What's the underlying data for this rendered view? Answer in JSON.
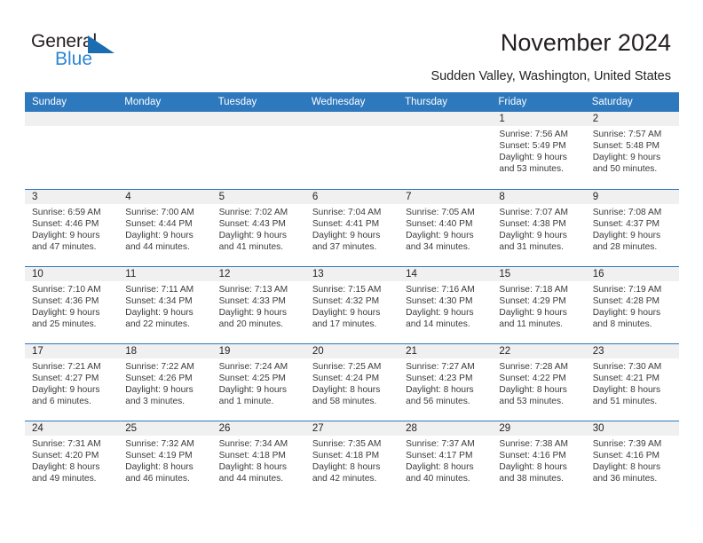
{
  "logo": {
    "word1": "General",
    "word2": "Blue",
    "triangle_color": "#1b6cb0",
    "word2_color": "#2b86d4"
  },
  "header": {
    "title": "November 2024",
    "subtitle": "Sudden Valley, Washington, United States"
  },
  "theme": {
    "header_blue": "#2e78bd",
    "daynum_gray": "#f0f0f0",
    "text": "#231f20"
  },
  "calendar": {
    "weekday_headers": [
      "Sunday",
      "Monday",
      "Tuesday",
      "Wednesday",
      "Thursday",
      "Friday",
      "Saturday"
    ],
    "weeks": [
      [
        {
          "day": "",
          "sunrise": "",
          "sunset": "",
          "daylight": "",
          "empty": true
        },
        {
          "day": "",
          "sunrise": "",
          "sunset": "",
          "daylight": "",
          "empty": true
        },
        {
          "day": "",
          "sunrise": "",
          "sunset": "",
          "daylight": "",
          "empty": true
        },
        {
          "day": "",
          "sunrise": "",
          "sunset": "",
          "daylight": "",
          "empty": true
        },
        {
          "day": "",
          "sunrise": "",
          "sunset": "",
          "daylight": "",
          "empty": true
        },
        {
          "day": "1",
          "sunrise": "Sunrise: 7:56 AM",
          "sunset": "Sunset: 5:49 PM",
          "daylight_l1": "Daylight: 9 hours",
          "daylight_l2": "and 53 minutes."
        },
        {
          "day": "2",
          "sunrise": "Sunrise: 7:57 AM",
          "sunset": "Sunset: 5:48 PM",
          "daylight_l1": "Daylight: 9 hours",
          "daylight_l2": "and 50 minutes."
        }
      ],
      [
        {
          "day": "3",
          "sunrise": "Sunrise: 6:59 AM",
          "sunset": "Sunset: 4:46 PM",
          "daylight_l1": "Daylight: 9 hours",
          "daylight_l2": "and 47 minutes."
        },
        {
          "day": "4",
          "sunrise": "Sunrise: 7:00 AM",
          "sunset": "Sunset: 4:44 PM",
          "daylight_l1": "Daylight: 9 hours",
          "daylight_l2": "and 44 minutes."
        },
        {
          "day": "5",
          "sunrise": "Sunrise: 7:02 AM",
          "sunset": "Sunset: 4:43 PM",
          "daylight_l1": "Daylight: 9 hours",
          "daylight_l2": "and 41 minutes."
        },
        {
          "day": "6",
          "sunrise": "Sunrise: 7:04 AM",
          "sunset": "Sunset: 4:41 PM",
          "daylight_l1": "Daylight: 9 hours",
          "daylight_l2": "and 37 minutes."
        },
        {
          "day": "7",
          "sunrise": "Sunrise: 7:05 AM",
          "sunset": "Sunset: 4:40 PM",
          "daylight_l1": "Daylight: 9 hours",
          "daylight_l2": "and 34 minutes."
        },
        {
          "day": "8",
          "sunrise": "Sunrise: 7:07 AM",
          "sunset": "Sunset: 4:38 PM",
          "daylight_l1": "Daylight: 9 hours",
          "daylight_l2": "and 31 minutes."
        },
        {
          "day": "9",
          "sunrise": "Sunrise: 7:08 AM",
          "sunset": "Sunset: 4:37 PM",
          "daylight_l1": "Daylight: 9 hours",
          "daylight_l2": "and 28 minutes."
        }
      ],
      [
        {
          "day": "10",
          "sunrise": "Sunrise: 7:10 AM",
          "sunset": "Sunset: 4:36 PM",
          "daylight_l1": "Daylight: 9 hours",
          "daylight_l2": "and 25 minutes."
        },
        {
          "day": "11",
          "sunrise": "Sunrise: 7:11 AM",
          "sunset": "Sunset: 4:34 PM",
          "daylight_l1": "Daylight: 9 hours",
          "daylight_l2": "and 22 minutes."
        },
        {
          "day": "12",
          "sunrise": "Sunrise: 7:13 AM",
          "sunset": "Sunset: 4:33 PM",
          "daylight_l1": "Daylight: 9 hours",
          "daylight_l2": "and 20 minutes."
        },
        {
          "day": "13",
          "sunrise": "Sunrise: 7:15 AM",
          "sunset": "Sunset: 4:32 PM",
          "daylight_l1": "Daylight: 9 hours",
          "daylight_l2": "and 17 minutes."
        },
        {
          "day": "14",
          "sunrise": "Sunrise: 7:16 AM",
          "sunset": "Sunset: 4:30 PM",
          "daylight_l1": "Daylight: 9 hours",
          "daylight_l2": "and 14 minutes."
        },
        {
          "day": "15",
          "sunrise": "Sunrise: 7:18 AM",
          "sunset": "Sunset: 4:29 PM",
          "daylight_l1": "Daylight: 9 hours",
          "daylight_l2": "and 11 minutes."
        },
        {
          "day": "16",
          "sunrise": "Sunrise: 7:19 AM",
          "sunset": "Sunset: 4:28 PM",
          "daylight_l1": "Daylight: 9 hours",
          "daylight_l2": "and 8 minutes."
        }
      ],
      [
        {
          "day": "17",
          "sunrise": "Sunrise: 7:21 AM",
          "sunset": "Sunset: 4:27 PM",
          "daylight_l1": "Daylight: 9 hours",
          "daylight_l2": "and 6 minutes."
        },
        {
          "day": "18",
          "sunrise": "Sunrise: 7:22 AM",
          "sunset": "Sunset: 4:26 PM",
          "daylight_l1": "Daylight: 9 hours",
          "daylight_l2": "and 3 minutes."
        },
        {
          "day": "19",
          "sunrise": "Sunrise: 7:24 AM",
          "sunset": "Sunset: 4:25 PM",
          "daylight_l1": "Daylight: 9 hours",
          "daylight_l2": "and 1 minute."
        },
        {
          "day": "20",
          "sunrise": "Sunrise: 7:25 AM",
          "sunset": "Sunset: 4:24 PM",
          "daylight_l1": "Daylight: 8 hours",
          "daylight_l2": "and 58 minutes."
        },
        {
          "day": "21",
          "sunrise": "Sunrise: 7:27 AM",
          "sunset": "Sunset: 4:23 PM",
          "daylight_l1": "Daylight: 8 hours",
          "daylight_l2": "and 56 minutes."
        },
        {
          "day": "22",
          "sunrise": "Sunrise: 7:28 AM",
          "sunset": "Sunset: 4:22 PM",
          "daylight_l1": "Daylight: 8 hours",
          "daylight_l2": "and 53 minutes."
        },
        {
          "day": "23",
          "sunrise": "Sunrise: 7:30 AM",
          "sunset": "Sunset: 4:21 PM",
          "daylight_l1": "Daylight: 8 hours",
          "daylight_l2": "and 51 minutes."
        }
      ],
      [
        {
          "day": "24",
          "sunrise": "Sunrise: 7:31 AM",
          "sunset": "Sunset: 4:20 PM",
          "daylight_l1": "Daylight: 8 hours",
          "daylight_l2": "and 49 minutes."
        },
        {
          "day": "25",
          "sunrise": "Sunrise: 7:32 AM",
          "sunset": "Sunset: 4:19 PM",
          "daylight_l1": "Daylight: 8 hours",
          "daylight_l2": "and 46 minutes."
        },
        {
          "day": "26",
          "sunrise": "Sunrise: 7:34 AM",
          "sunset": "Sunset: 4:18 PM",
          "daylight_l1": "Daylight: 8 hours",
          "daylight_l2": "and 44 minutes."
        },
        {
          "day": "27",
          "sunrise": "Sunrise: 7:35 AM",
          "sunset": "Sunset: 4:18 PM",
          "daylight_l1": "Daylight: 8 hours",
          "daylight_l2": "and 42 minutes."
        },
        {
          "day": "28",
          "sunrise": "Sunrise: 7:37 AM",
          "sunset": "Sunset: 4:17 PM",
          "daylight_l1": "Daylight: 8 hours",
          "daylight_l2": "and 40 minutes."
        },
        {
          "day": "29",
          "sunrise": "Sunrise: 7:38 AM",
          "sunset": "Sunset: 4:16 PM",
          "daylight_l1": "Daylight: 8 hours",
          "daylight_l2": "and 38 minutes."
        },
        {
          "day": "30",
          "sunrise": "Sunrise: 7:39 AM",
          "sunset": "Sunset: 4:16 PM",
          "daylight_l1": "Daylight: 8 hours",
          "daylight_l2": "and 36 minutes."
        }
      ]
    ]
  }
}
